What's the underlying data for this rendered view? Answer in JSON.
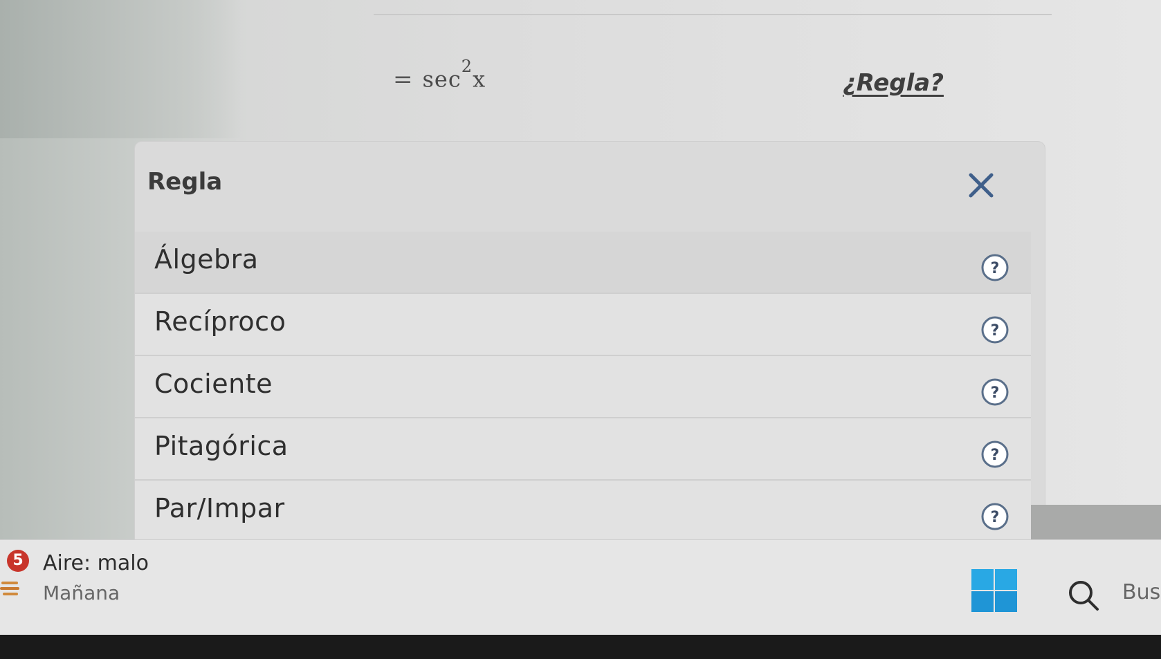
{
  "equation": {
    "equals": "=",
    "function": "sec",
    "exponent": "2",
    "variable": "x"
  },
  "rule_link": "¿Regla?",
  "panel": {
    "title": "Regla",
    "rules": [
      {
        "label": "Álgebra"
      },
      {
        "label": "Recíproco"
      },
      {
        "label": "Cociente"
      },
      {
        "label": "Pitagórica"
      },
      {
        "label": "Par/Impar"
      }
    ]
  },
  "taskbar": {
    "weather": {
      "badge": "5",
      "title": "Aire: malo",
      "subtitle": "Mañana"
    },
    "search_text": "Bus"
  },
  "colors": {
    "accent_start": "#1aa0e0",
    "badge_red": "#c8352b"
  }
}
